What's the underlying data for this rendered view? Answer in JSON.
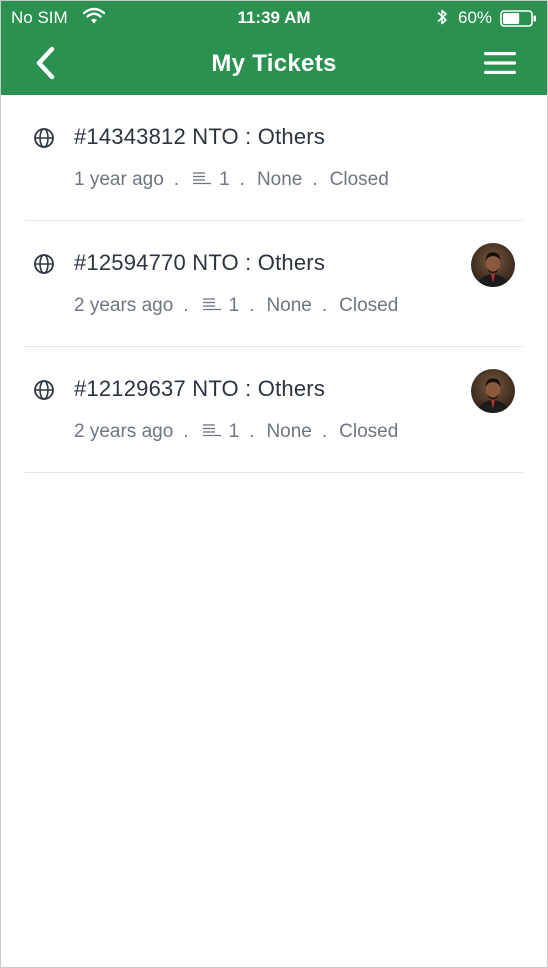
{
  "status_bar": {
    "carrier": "No SIM",
    "time": "11:39 AM",
    "battery_percent": "60%",
    "battery_level": 0.6
  },
  "nav": {
    "title": "My Tickets",
    "back_icon": "chevron-left-icon",
    "menu_icon": "hamburger-menu-icon"
  },
  "theme": {
    "header_color": "#2b9150"
  },
  "tickets": [
    {
      "title": "#14343812 NTO : Others",
      "age": "1 year ago",
      "sep1": ".",
      "count": "1",
      "sep2": ".",
      "priority": "None",
      "sep3": ".",
      "status": "Closed",
      "has_avatar": false
    },
    {
      "title": "#12594770 NTO : Others",
      "age": "2 years ago",
      "sep1": ".",
      "count": "1",
      "sep2": ".",
      "priority": "None",
      "sep3": ".",
      "status": "Closed",
      "has_avatar": true
    },
    {
      "title": "#12129637 NTO : Others",
      "age": "2 years ago",
      "sep1": ".",
      "count": "1",
      "sep2": ".",
      "priority": "None",
      "sep3": ".",
      "status": "Closed",
      "has_avatar": true
    }
  ]
}
